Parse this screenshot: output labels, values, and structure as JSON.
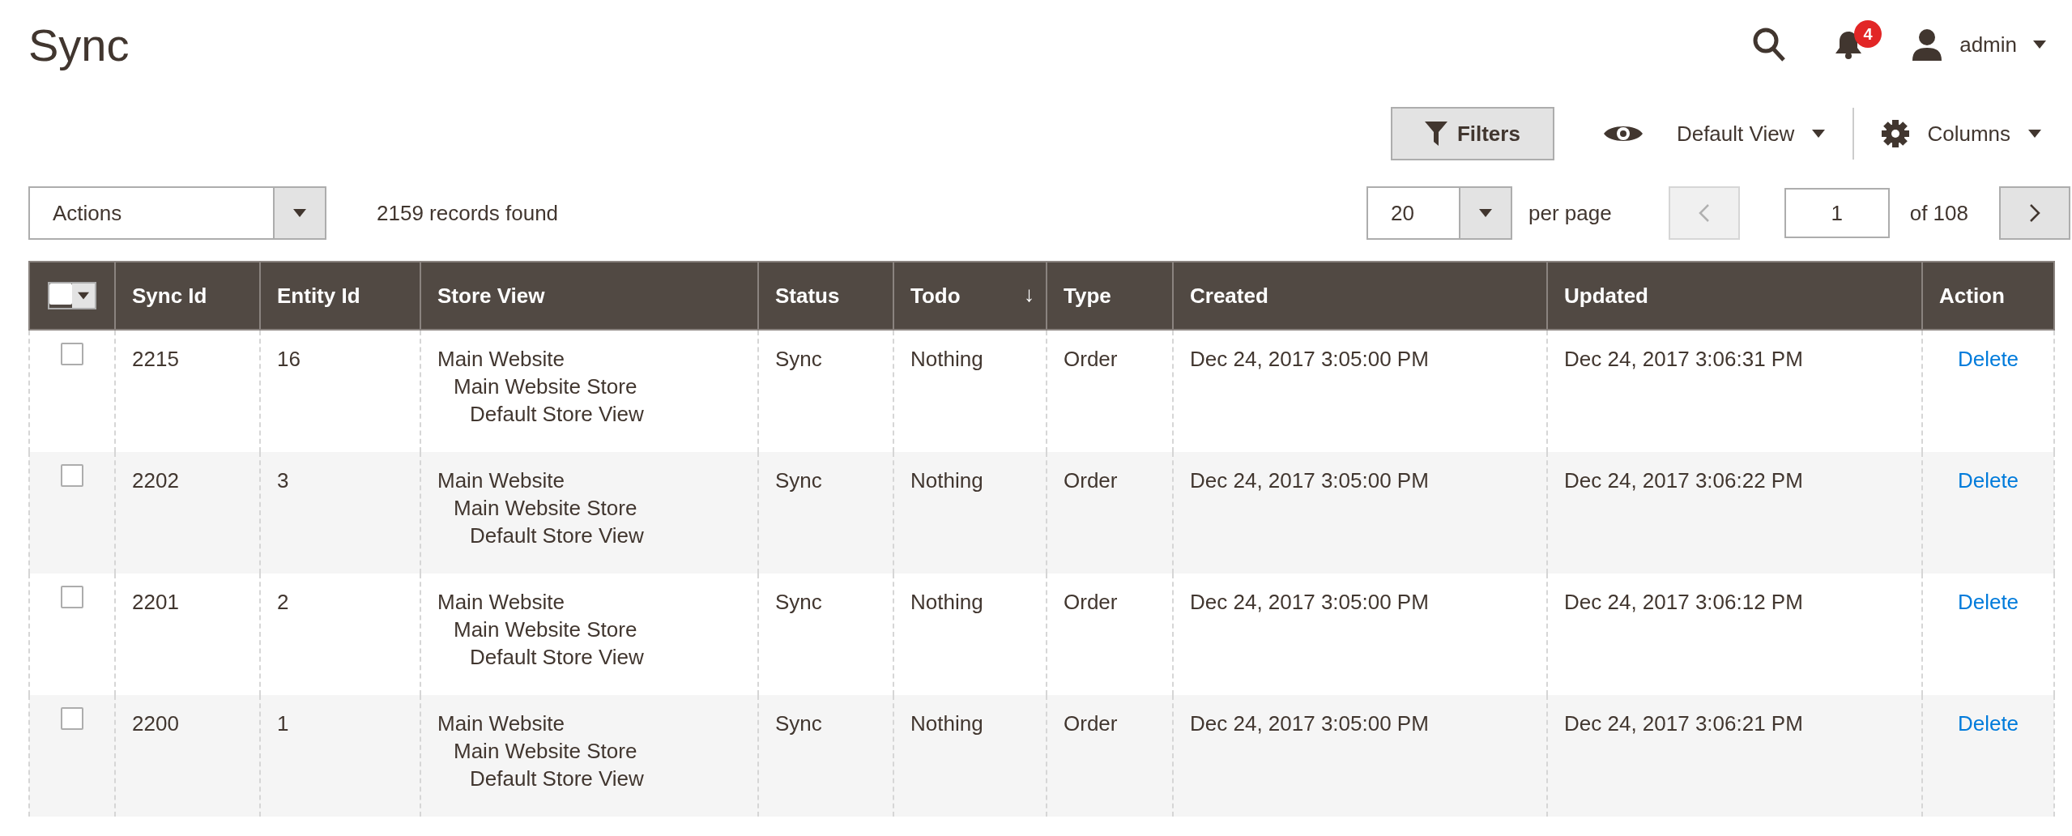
{
  "page_title": "Sync",
  "header": {
    "notifications_count": "4",
    "user": "admin"
  },
  "toolbar": {
    "filters_button": "Filters",
    "view": "Default View",
    "columns": "Columns"
  },
  "controls": {
    "actions": "Actions",
    "records": "2159 records found",
    "per_page_value": "20",
    "per_page_label": "per page",
    "prev_disabled": true,
    "page": "1",
    "page_total": "of 108",
    "next_disabled": false
  },
  "table": {
    "select_all_checked": false,
    "columns": [
      {
        "label": "Sync Id"
      },
      {
        "label": "Entity Id"
      },
      {
        "label": "Store View"
      },
      {
        "label": "Status"
      },
      {
        "label": "Todo",
        "sort": "↓"
      },
      {
        "label": "Type"
      },
      {
        "label": "Created"
      },
      {
        "label": "Updated"
      },
      {
        "label": "Action"
      }
    ],
    "rows": [
      {
        "checked": false,
        "sync_id": "2215",
        "entity_id": "16",
        "store_view": {
          "label": "Main Website",
          "children": [
            {
              "label": "Main Website Store",
              "children": [
                {
                  "label": "Default Store View"
                }
              ]
            }
          ]
        },
        "status": "Sync",
        "todo": "Nothing",
        "type": "Order",
        "created": "Dec 24, 2017 3:05:00 PM",
        "updated": "Dec 24, 2017 3:06:31 PM",
        "action": "Delete"
      },
      {
        "checked": false,
        "sync_id": "2202",
        "entity_id": "3",
        "store_view": {
          "label": "Main Website",
          "children": [
            {
              "label": "Main Website Store",
              "children": [
                {
                  "label": "Default Store View"
                }
              ]
            }
          ]
        },
        "status": "Sync",
        "todo": "Nothing",
        "type": "Order",
        "created": "Dec 24, 2017 3:05:00 PM",
        "updated": "Dec 24, 2017 3:06:22 PM",
        "action": "Delete"
      },
      {
        "checked": false,
        "sync_id": "2201",
        "entity_id": "2",
        "store_view": {
          "label": "Main Website",
          "children": [
            {
              "label": "Main Website Store",
              "children": [
                {
                  "label": "Default Store View"
                }
              ]
            }
          ]
        },
        "status": "Sync",
        "todo": "Nothing",
        "type": "Order",
        "created": "Dec 24, 2017 3:05:00 PM",
        "updated": "Dec 24, 2017 3:06:12 PM",
        "action": "Delete"
      },
      {
        "checked": false,
        "sync_id": "2200",
        "entity_id": "1",
        "store_view": {
          "label": "Main Website",
          "children": [
            {
              "label": "Main Website Store",
              "children": [
                {
                  "label": "Default Store View"
                }
              ]
            }
          ]
        },
        "status": "Sync",
        "todo": "Nothing",
        "type": "Order",
        "created": "Dec 24, 2017 3:05:00 PM",
        "updated": "Dec 24, 2017 3:06:21 PM",
        "action": "Delete"
      }
    ]
  }
}
